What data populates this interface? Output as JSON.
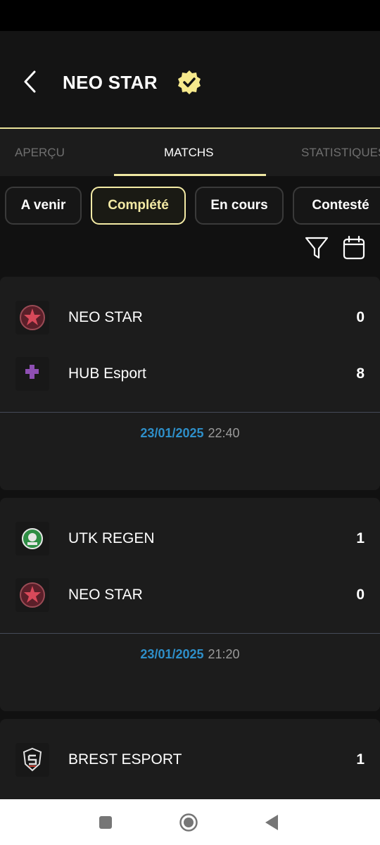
{
  "header": {
    "title": "NEO STAR"
  },
  "tabs": [
    {
      "label": "APERÇU"
    },
    {
      "label": "MATCHS"
    },
    {
      "label": "STATISTIQUES"
    }
  ],
  "filters": [
    {
      "label": "A venir"
    },
    {
      "label": "Complété"
    },
    {
      "label": "En cours"
    },
    {
      "label": "Contesté"
    }
  ],
  "matches": [
    {
      "teams": [
        {
          "name": "NEO STAR",
          "score": "0",
          "logo": "neo-star-logo"
        },
        {
          "name": "HUB Esport",
          "score": "8",
          "logo": "hub-esport-logo"
        }
      ],
      "date": "23/01/2025",
      "time": "22:40"
    },
    {
      "teams": [
        {
          "name": "UTK REGEN",
          "score": "1",
          "logo": "utk-regen-logo"
        },
        {
          "name": "NEO STAR",
          "score": "0",
          "logo": "neo-star-logo"
        }
      ],
      "date": "23/01/2025",
      "time": "21:20"
    },
    {
      "teams": [
        {
          "name": "BREST ESPORT",
          "score": "1",
          "logo": "brest-esport-logo"
        }
      ]
    }
  ],
  "colors": {
    "accent": "#f3eaa5",
    "date_blue": "#2e8fc9",
    "background": "#111111",
    "card": "#1c1c1c"
  },
  "icons": [
    "back-arrow-icon",
    "verified-badge-icon",
    "filter-icon",
    "calendar-icon",
    "nav-recents-icon",
    "nav-home-icon",
    "nav-back-icon"
  ]
}
